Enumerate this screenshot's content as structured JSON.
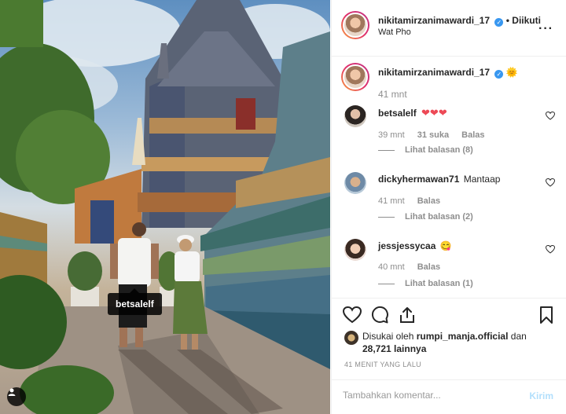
{
  "photo": {
    "tagged_user": "betsalelf",
    "user_tag_icon": "user-icon"
  },
  "header": {
    "username": "nikitamirzanimawardi_17",
    "follow_state": "• Diikuti",
    "location": "Wat Pho",
    "more_icon": "more-horizontal-icon"
  },
  "caption": {
    "username": "nikitamirzanimawardi_17",
    "emoji": "🌞",
    "time": "41 mnt"
  },
  "comments": [
    {
      "username": "betsalelf",
      "text": "❤❤❤",
      "time": "39 mnt",
      "likes": "31 suka",
      "reply": "Balas",
      "view_replies": "Lihat balasan (8)"
    },
    {
      "username": "dickyhermawan71",
      "text": "Mantaap",
      "time": "41 mnt",
      "reply": "Balas",
      "view_replies": "Lihat balasan (2)"
    },
    {
      "username": "jessjessycaa",
      "text": "😋",
      "time": "40 mnt",
      "reply": "Balas",
      "view_replies": "Lihat balasan (1)"
    }
  ],
  "actions": {
    "liked_by_prefix": "Disukai oleh",
    "liked_by_user": "rumpi_manja.official",
    "and": "dan",
    "others": "28,721 lainnya",
    "time_ago": "41 MENIT YANG LALU"
  },
  "composer": {
    "placeholder": "Tambahkan komentar...",
    "post_label": "Kirim"
  },
  "colors": {
    "accent_blue": "#3897f0",
    "post_disabled": "#b2dffc",
    "heart_red": "#ed4956"
  }
}
